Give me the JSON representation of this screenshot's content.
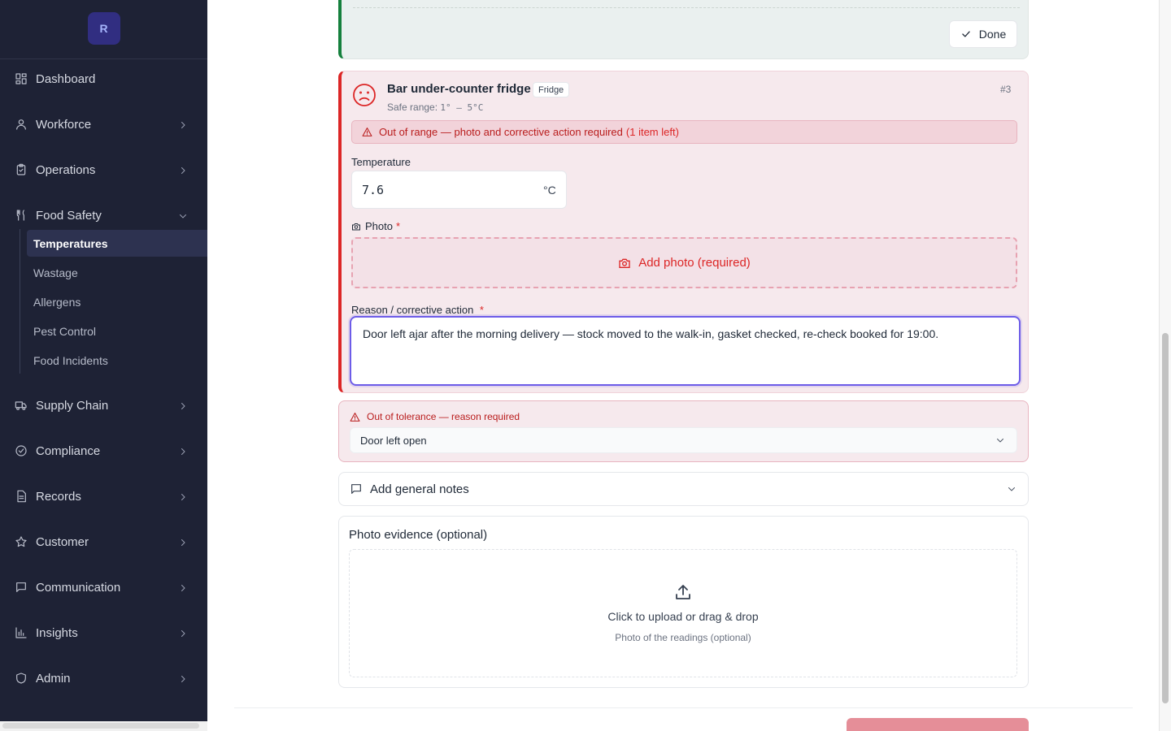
{
  "sidebar": {
    "logo_letter": "R",
    "items": [
      {
        "label": "Dashboard"
      },
      {
        "label": "Workforce"
      },
      {
        "label": "Operations"
      },
      {
        "label": "Food Safety"
      },
      {
        "label": "Supply Chain"
      },
      {
        "label": "Compliance"
      },
      {
        "label": "Records"
      },
      {
        "label": "Customer"
      },
      {
        "label": "Communication"
      },
      {
        "label": "Insights"
      },
      {
        "label": "Admin"
      }
    ],
    "food_safety_sub": [
      {
        "label": "Temperatures",
        "active": true
      },
      {
        "label": "Wastage"
      },
      {
        "label": "Allergens"
      },
      {
        "label": "Pest Control"
      },
      {
        "label": "Food Incidents"
      }
    ]
  },
  "previous_item": {
    "done_label": "Done"
  },
  "item": {
    "title": "Bar under-counter fridge",
    "type_chip": "Fridge",
    "number": "#3",
    "safe_range_label": "Safe range:",
    "safe_range_value": "1° – 5°C",
    "alert_text": "Out of range — photo and corrective action required",
    "alert_count": "(1 item left)",
    "temperature_label": "Temperature",
    "temperature_value": "7.6",
    "temperature_unit": "°C",
    "photo_label": "Photo",
    "required_mark": "*",
    "add_photo_label": "Add photo (required)",
    "reason_label": "Reason / corrective action",
    "reason_value": "Door left ajar after the morning delivery — stock moved to the walk-in, gasket checked, re-check booked for 19:00."
  },
  "tolerance": {
    "heading": "Out of tolerance — reason required",
    "selected": "Door left open"
  },
  "notes": {
    "label": "Add general notes"
  },
  "evidence": {
    "title": "Photo evidence (optional)",
    "dropzone_main": "Click to upload or drag & drop",
    "dropzone_sub": "Photo of the readings (optional)"
  },
  "colors": {
    "sidebar_bg": "#1e2235",
    "alert_red": "#dc2626",
    "done_green": "#15803d",
    "focus_purple": "#6d5ce8"
  }
}
